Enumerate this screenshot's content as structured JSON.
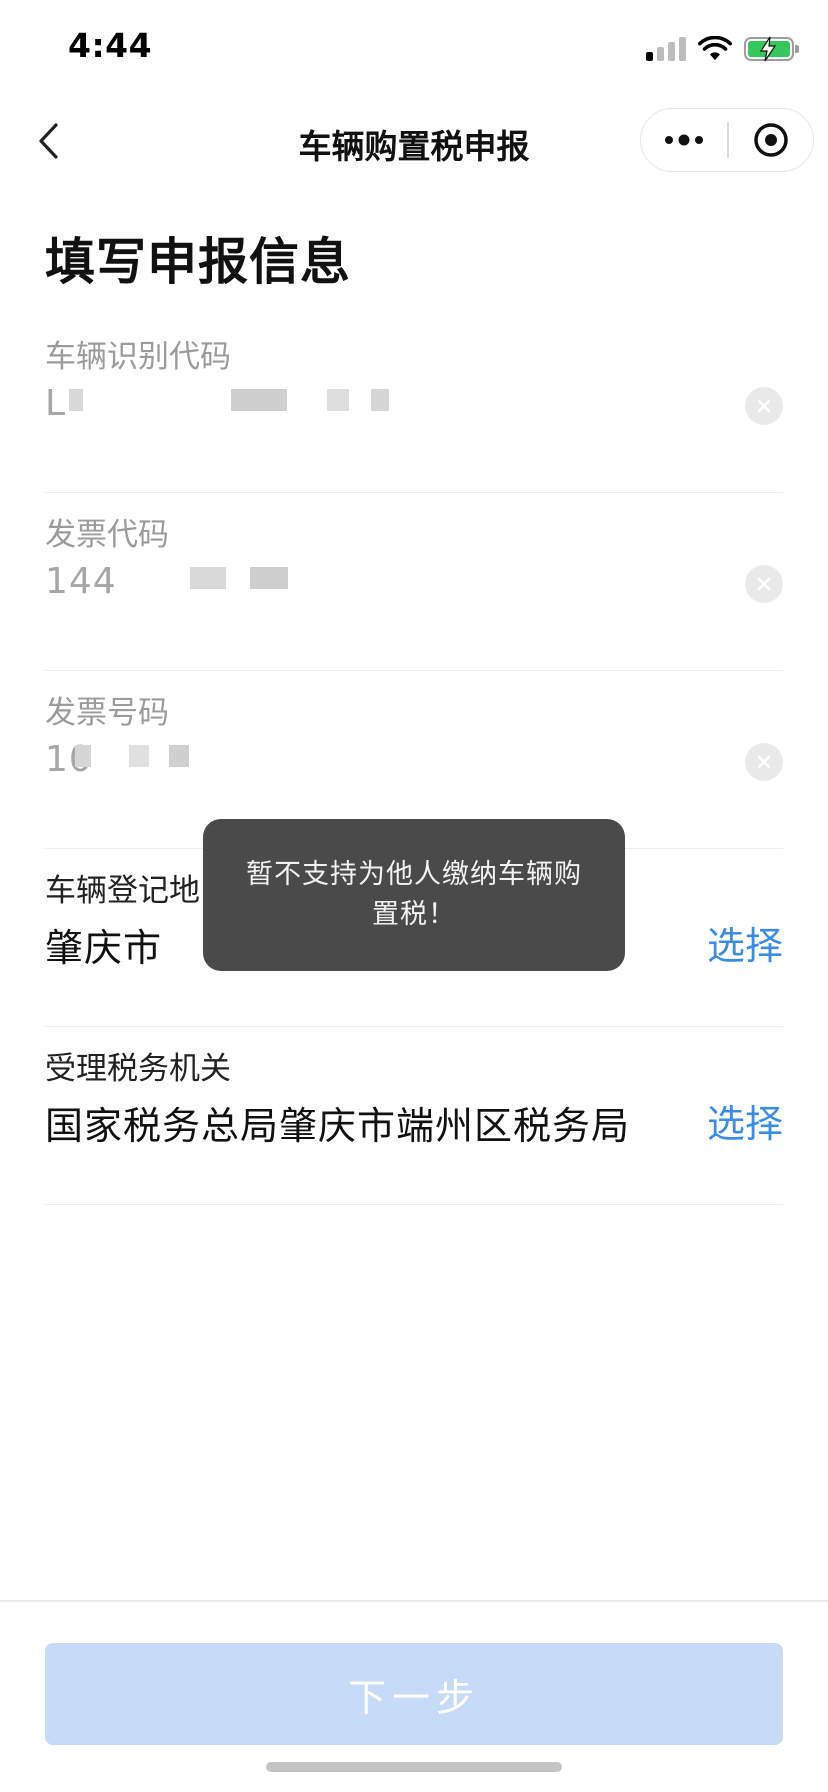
{
  "status_bar": {
    "time": "4:44",
    "signal_icon": "signal-icon",
    "wifi_icon": "wifi-icon",
    "battery_icon": "battery-charging-icon",
    "battery_color": "#34c759"
  },
  "nav": {
    "back_icon": "chevron-left-icon",
    "title": "车辆购置税申报",
    "more_icon": "more-dots-icon",
    "close_icon": "target-close-icon"
  },
  "page_title": "填写申报信息",
  "fields": {
    "vin": {
      "label": "车辆识别代码",
      "value": "L",
      "clear_icon": "clear-icon"
    },
    "invoice_code": {
      "label": "发票代码",
      "value": "144",
      "clear_icon": "clear-icon"
    },
    "invoice_number": {
      "label": "发票号码",
      "value": "10",
      "clear_icon": "clear-icon"
    },
    "registration_place": {
      "label": "车辆登记地",
      "value": "肇庆市",
      "action": "选择"
    },
    "tax_office": {
      "label": "受理税务机关",
      "value": "国家税务总局肇庆市端州区税务局",
      "action": "选择"
    }
  },
  "toast": {
    "message": "暂不支持为他人缴纳车辆购置税！"
  },
  "footer": {
    "next_label": "下一步"
  },
  "colors": {
    "accent": "#3b8ce6",
    "button_disabled": "#c6dbf8",
    "toast_bg": "#3c3c3c"
  }
}
